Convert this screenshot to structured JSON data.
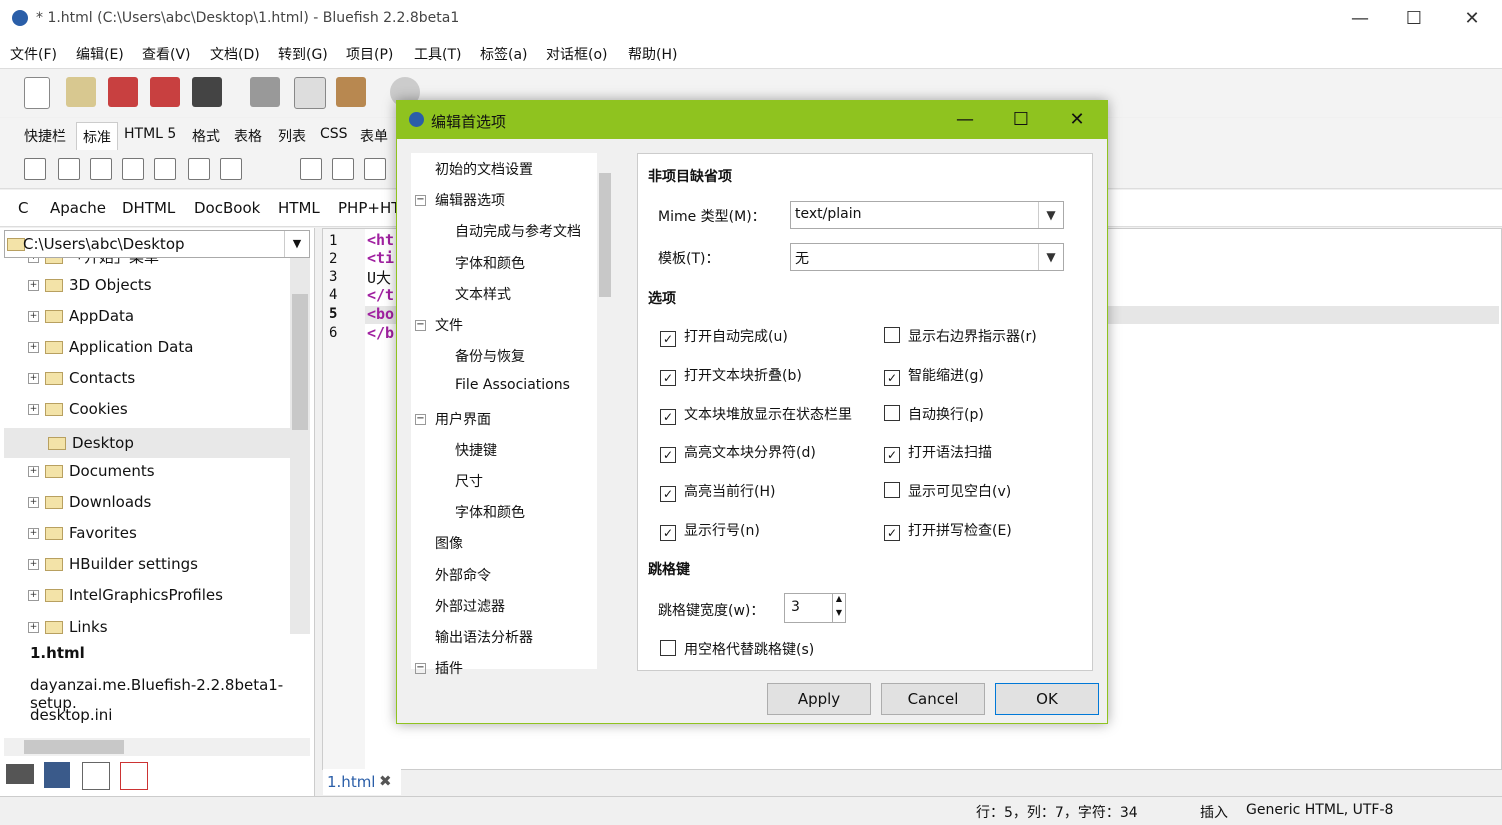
{
  "window": {
    "title": "* 1.html (C:\\Users\\abc\\Desktop\\1.html) - Bluefish 2.2.8beta1"
  },
  "menu": [
    "文件(F)",
    "编辑(E)",
    "查看(V)",
    "文档(D)",
    "转到(G)",
    "项目(P)",
    "工具(T)",
    "标签(a)",
    "对话框(o)",
    "帮助(H)"
  ],
  "tabs": [
    "快捷栏",
    "标准",
    "HTML 5",
    "格式",
    "表格",
    "列表",
    "CSS",
    "表单"
  ],
  "languages": [
    "C",
    "Apache",
    "DHTML",
    "DocBook",
    "HTML",
    "PHP+HT"
  ],
  "leftpanel": {
    "path": "C:\\Users\\abc\\Desktop",
    "tree": [
      "「开始」菜单",
      "3D Objects",
      "AppData",
      "Application Data",
      "Contacts",
      "Cookies",
      "Desktop",
      "Documents",
      "Downloads",
      "Favorites",
      "HBuilder settings",
      "IntelGraphicsProfiles",
      "Links"
    ],
    "files": [
      "1.html",
      "dayanzai.me.Bluefish-2.2.8beta1-setup.",
      "desktop.ini"
    ]
  },
  "editor": {
    "lines": [
      "1",
      "2",
      "3",
      "4",
      "5",
      "6"
    ],
    "code": [
      "<ht",
      "<ti",
      "U大",
      "</t",
      "<bo",
      "</b"
    ],
    "tab_label": "1.html"
  },
  "status": {
    "position": "行：5，列：7，字符：34",
    "mode": "插入",
    "encoding": "Generic HTML, UTF-8"
  },
  "dialog": {
    "title": "编辑首选项",
    "nav": [
      {
        "label": "初始的文档设置",
        "level": 0
      },
      {
        "label": "编辑器选项",
        "level": 0,
        "exp": "⊟"
      },
      {
        "label": "自动完成与参考文档",
        "level": 1
      },
      {
        "label": "字体和颜色",
        "level": 1
      },
      {
        "label": "文本样式",
        "level": 1
      },
      {
        "label": "文件",
        "level": 0,
        "exp": "⊟"
      },
      {
        "label": "备份与恢复",
        "level": 1
      },
      {
        "label": "File Associations",
        "level": 1
      },
      {
        "label": "用户界面",
        "level": 0,
        "exp": "⊟"
      },
      {
        "label": "快捷键",
        "level": 1
      },
      {
        "label": "尺寸",
        "level": 1
      },
      {
        "label": "字体和颜色",
        "level": 1
      },
      {
        "label": "图像",
        "level": 0
      },
      {
        "label": "外部命令",
        "level": 0
      },
      {
        "label": "外部过滤器",
        "level": 0
      },
      {
        "label": "输出语法分析器",
        "level": 0
      },
      {
        "label": "插件",
        "level": 0,
        "exp": "⊟"
      }
    ],
    "section_defaults": "非项目缺省项",
    "mime_label": "Mime 类型(M)：",
    "mime_value": "text/plain",
    "template_label": "模板(T)：",
    "template_value": "无",
    "section_options": "选项",
    "options_left": [
      {
        "label": "打开自动完成(u)",
        "checked": true
      },
      {
        "label": "打开文本块折叠(b)",
        "checked": true
      },
      {
        "label": "文本块堆放显示在状态栏里",
        "checked": true
      },
      {
        "label": "高亮文本块分界符(d)",
        "checked": true
      },
      {
        "label": "高亮当前行(H)",
        "checked": true
      },
      {
        "label": "显示行号(n)",
        "checked": true
      }
    ],
    "options_right": [
      {
        "label": "显示右边界指示器(r)",
        "checked": false
      },
      {
        "label": "智能缩进(g)",
        "checked": true
      },
      {
        "label": "自动换行(p)",
        "checked": false
      },
      {
        "label": "打开语法扫描",
        "checked": true
      },
      {
        "label": "显示可见空白(v)",
        "checked": false
      },
      {
        "label": "打开拼写检查(E)",
        "checked": true
      }
    ],
    "section_tab": "跳格键",
    "tab_width_label": "跳格键宽度(w)：",
    "tab_width_value": "3",
    "spaces_option": {
      "label": "用空格代替跳格键(s)",
      "checked": false
    },
    "buttons": {
      "apply": "Apply",
      "cancel": "Cancel",
      "ok": "OK"
    }
  },
  "colors": {
    "dialog_accent": "#8fc31f",
    "code_tag": "#a020a0"
  }
}
